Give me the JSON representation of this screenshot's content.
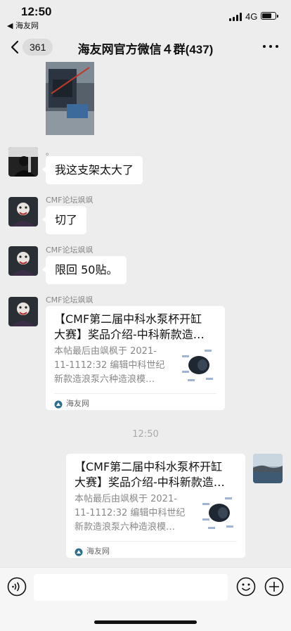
{
  "status_bar": {
    "time": "12:50",
    "back_app": "◀ 海友网",
    "network": "4G",
    "battery_level": 0.75
  },
  "nav": {
    "unread_count": "361",
    "title": "海友网官方微信４群(437)"
  },
  "messages": [
    {
      "type": "image",
      "side": "left"
    },
    {
      "type": "text",
      "side": "left",
      "sender": "。",
      "text": "我这支架太大了"
    },
    {
      "type": "text",
      "side": "left",
      "sender": "CMF论坛飒飒",
      "text": "切了"
    },
    {
      "type": "text",
      "side": "left",
      "sender": "CMF论坛飒飒",
      "text": "限回 50贴。"
    },
    {
      "type": "link",
      "side": "left",
      "sender": "CMF论坛飒飒",
      "title_line1": "【CMF第二届中科水泵杯开缸",
      "title_line2": "大赛】奖品介绍-中科新款造…",
      "desc_line1": "本帖最后由飒枫于 2021-",
      "desc_line2": "11-1112:32 编辑中科世纪",
      "desc_line3": "新款造浪泵六种造浪模…",
      "source": "海友网"
    },
    {
      "type": "timestamp",
      "text": "12:50"
    },
    {
      "type": "link",
      "side": "right",
      "title_line1": "【CMF第二届中科水泵杯开缸",
      "title_line2": "大赛】奖品介绍-中科新款造…",
      "desc_line1": "本帖最后由飒枫于 2021-",
      "desc_line2": "11-1112:32 编辑中科世纪",
      "desc_line3": "新款造浪泵六种造浪模…",
      "source": "海友网"
    }
  ],
  "icons": {
    "back": "chevron-left-icon",
    "more": "more-dots-icon",
    "voice": "voice-icon",
    "emoji": "emoji-icon",
    "add": "plus-icon"
  }
}
